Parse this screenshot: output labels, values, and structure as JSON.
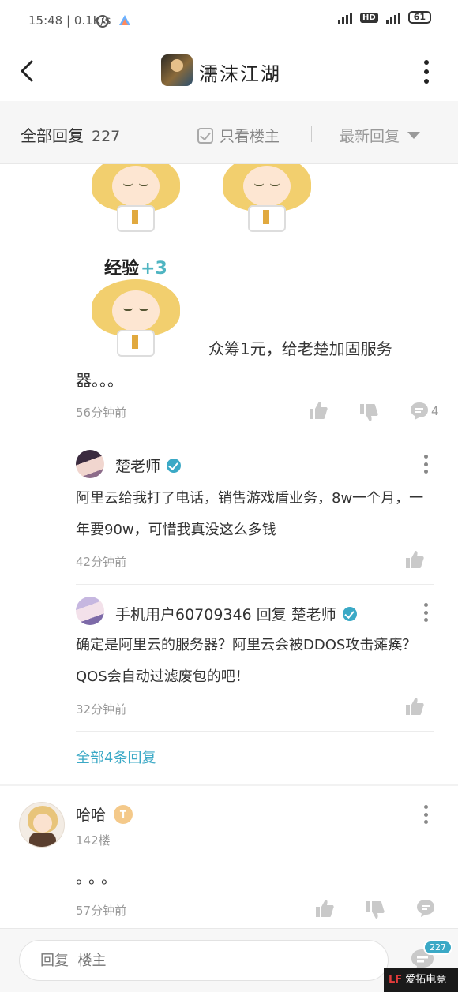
{
  "status": {
    "time": "15:48",
    "speed": "0.1K/s",
    "hd": "HD",
    "battery": "61"
  },
  "header": {
    "title": "濡沫江湖"
  },
  "filter": {
    "all_replies": "全部回复",
    "count": "227",
    "only_op": "只看楼主",
    "sort": "最新回复"
  },
  "post": {
    "exp_label": "经验",
    "exp_plus": "+3",
    "text": "众筹1元，给老楚加固服务器。。。",
    "time": "56分钟前",
    "comments": "4"
  },
  "replies": [
    {
      "name": "楚老师",
      "text": "阿里云给我打了电话，销售游戏盾业务，8w一个月，一年要90w，可惜我真没这么多钱",
      "time": "42分钟前"
    },
    {
      "name": "手机用户60709346 回复 楚老师",
      "text": "确定是阿里云的服务器？阿里云会被DDOS攻击瘫痪？QOS会自动过滤废包的吧！",
      "time": "32分钟前"
    }
  ],
  "all_replies_link": "全部4条回复",
  "next_post": {
    "name": "哈哈",
    "level": "T",
    "floor": "142楼",
    "text": "。。。",
    "time": "57分钟前"
  },
  "bottom": {
    "placeholder": "回复  楼主",
    "count": "227"
  },
  "watermark": {
    "logo": "LF",
    "text": "爱拓电竞"
  }
}
